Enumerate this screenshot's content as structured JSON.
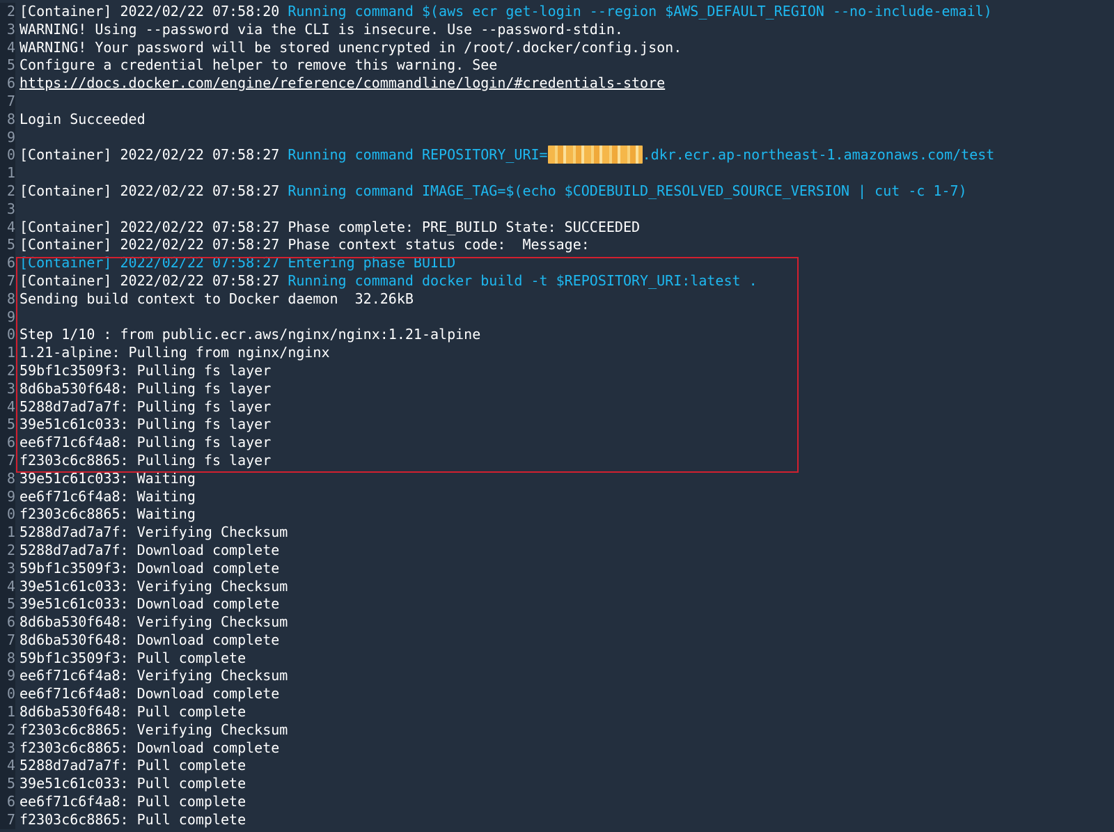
{
  "lines": [
    {
      "num": "2",
      "segments": [
        {
          "text": "[Container] 2022/02/22 07:58:20 ",
          "style": "normal"
        },
        {
          "text": "Running command $(aws ecr get-login --region $AWS_DEFAULT_REGION --no-include-email)",
          "style": "cmd"
        }
      ]
    },
    {
      "num": "3",
      "segments": [
        {
          "text": "WARNING! Using --password via the CLI is insecure. Use --password-stdin.",
          "style": "normal"
        }
      ]
    },
    {
      "num": "4",
      "segments": [
        {
          "text": "WARNING! Your password will be stored unencrypted in /root/.docker/config.json.",
          "style": "normal"
        }
      ]
    },
    {
      "num": "5",
      "segments": [
        {
          "text": "Configure a credential helper to remove this warning. See",
          "style": "normal"
        }
      ]
    },
    {
      "num": "6",
      "segments": [
        {
          "text": "https://docs.docker.com/engine/reference/commandline/login/#credentials-store",
          "style": "link"
        }
      ]
    },
    {
      "num": "7",
      "segments": []
    },
    {
      "num": "8",
      "segments": [
        {
          "text": "Login Succeeded",
          "style": "normal"
        }
      ]
    },
    {
      "num": "9",
      "segments": []
    },
    {
      "num": "0",
      "segments": [
        {
          "text": "[Container] 2022/02/22 07:58:27 ",
          "style": "normal"
        },
        {
          "text": "Running command REPOSITORY_URI=",
          "style": "cmd"
        },
        {
          "text": "",
          "style": "redacted"
        },
        {
          "text": ".dkr.ecr.ap-northeast-1.amazonaws.com/test",
          "style": "cmd"
        }
      ]
    },
    {
      "num": "1",
      "segments": []
    },
    {
      "num": "2",
      "segments": [
        {
          "text": "[Container] 2022/02/22 07:58:27 ",
          "style": "normal"
        },
        {
          "text": "Running command IMAGE_TAG=$(echo $CODEBUILD_RESOLVED_SOURCE_VERSION | cut -c 1-7)",
          "style": "cmd"
        }
      ]
    },
    {
      "num": "3",
      "segments": []
    },
    {
      "num": "4",
      "segments": [
        {
          "text": "[Container] 2022/02/22 07:58:27 Phase complete: PRE_BUILD State: SUCCEEDED",
          "style": "normal"
        }
      ]
    },
    {
      "num": "5",
      "segments": [
        {
          "text": "[Container] 2022/02/22 07:58:27 Phase context status code:  Message:",
          "style": "normal"
        }
      ]
    },
    {
      "num": "6",
      "segments": [
        {
          "text": "[Container] 2022/02/22 07:58:27 Entering phase BUILD",
          "style": "cmd"
        }
      ]
    },
    {
      "num": "7",
      "segments": [
        {
          "text": "[Container] 2022/02/22 07:58:27 ",
          "style": "normal"
        },
        {
          "text": "Running command docker build -t $REPOSITORY_URI:latest .",
          "style": "cmd"
        }
      ]
    },
    {
      "num": "8",
      "segments": [
        {
          "text": "Sending build context to Docker daemon  32.26kB",
          "style": "normal"
        }
      ]
    },
    {
      "num": "9",
      "segments": []
    },
    {
      "num": "0",
      "segments": [
        {
          "text": "Step 1/10 : from public.ecr.aws/nginx/nginx:1.21-alpine",
          "style": "normal"
        }
      ]
    },
    {
      "num": "1",
      "segments": [
        {
          "text": "1.21-alpine: Pulling from nginx/nginx",
          "style": "normal"
        }
      ]
    },
    {
      "num": "2",
      "segments": [
        {
          "text": "59bf1c3509f3: Pulling fs layer",
          "style": "normal"
        }
      ]
    },
    {
      "num": "3",
      "segments": [
        {
          "text": "8d6ba530f648: Pulling fs layer",
          "style": "normal"
        }
      ]
    },
    {
      "num": "4",
      "segments": [
        {
          "text": "5288d7ad7a7f: Pulling fs layer",
          "style": "normal"
        }
      ]
    },
    {
      "num": "5",
      "segments": [
        {
          "text": "39e51c61c033: Pulling fs layer",
          "style": "normal"
        }
      ]
    },
    {
      "num": "6",
      "segments": [
        {
          "text": "ee6f71c6f4a8: Pulling fs layer",
          "style": "normal"
        }
      ]
    },
    {
      "num": "7",
      "segments": [
        {
          "text": "f2303c6c8865: Pulling fs layer",
          "style": "normal"
        }
      ]
    },
    {
      "num": "8",
      "segments": [
        {
          "text": "39e51c61c033: Waiting",
          "style": "normal"
        }
      ]
    },
    {
      "num": "9",
      "segments": [
        {
          "text": "ee6f71c6f4a8: Waiting",
          "style": "normal"
        }
      ]
    },
    {
      "num": "0",
      "segments": [
        {
          "text": "f2303c6c8865: Waiting",
          "style": "normal"
        }
      ]
    },
    {
      "num": "1",
      "segments": [
        {
          "text": "5288d7ad7a7f: Verifying Checksum",
          "style": "normal"
        }
      ]
    },
    {
      "num": "2",
      "segments": [
        {
          "text": "5288d7ad7a7f: Download complete",
          "style": "normal"
        }
      ]
    },
    {
      "num": "3",
      "segments": [
        {
          "text": "59bf1c3509f3: Download complete",
          "style": "normal"
        }
      ]
    },
    {
      "num": "4",
      "segments": [
        {
          "text": "39e51c61c033: Verifying Checksum",
          "style": "normal"
        }
      ]
    },
    {
      "num": "5",
      "segments": [
        {
          "text": "39e51c61c033: Download complete",
          "style": "normal"
        }
      ]
    },
    {
      "num": "6",
      "segments": [
        {
          "text": "8d6ba530f648: Verifying Checksum",
          "style": "normal"
        }
      ]
    },
    {
      "num": "7",
      "segments": [
        {
          "text": "8d6ba530f648: Download complete",
          "style": "normal"
        }
      ]
    },
    {
      "num": "8",
      "segments": [
        {
          "text": "59bf1c3509f3: Pull complete",
          "style": "normal"
        }
      ]
    },
    {
      "num": "9",
      "segments": [
        {
          "text": "ee6f71c6f4a8: Verifying Checksum",
          "style": "normal"
        }
      ]
    },
    {
      "num": "0",
      "segments": [
        {
          "text": "ee6f71c6f4a8: Download complete",
          "style": "normal"
        }
      ]
    },
    {
      "num": "1",
      "segments": [
        {
          "text": "8d6ba530f648: Pull complete",
          "style": "normal"
        }
      ]
    },
    {
      "num": "2",
      "segments": [
        {
          "text": "f2303c6c8865: Verifying Checksum",
          "style": "normal"
        }
      ]
    },
    {
      "num": "3",
      "segments": [
        {
          "text": "f2303c6c8865: Download complete",
          "style": "normal"
        }
      ]
    },
    {
      "num": "4",
      "segments": [
        {
          "text": "5288d7ad7a7f: Pull complete",
          "style": "normal"
        }
      ]
    },
    {
      "num": "5",
      "segments": [
        {
          "text": "39e51c61c033: Pull complete",
          "style": "normal"
        }
      ]
    },
    {
      "num": "6",
      "segments": [
        {
          "text": "ee6f71c6f4a8: Pull complete",
          "style": "normal"
        }
      ]
    },
    {
      "num": "7",
      "segments": [
        {
          "text": "f2303c6c8865: Pull complete",
          "style": "normal"
        }
      ]
    }
  ],
  "colors": {
    "background": "#232f3e",
    "text": "#ffffff",
    "command": "#1eb8f0",
    "highlight_border": "#d2202f",
    "redaction": "#f5b74a"
  }
}
